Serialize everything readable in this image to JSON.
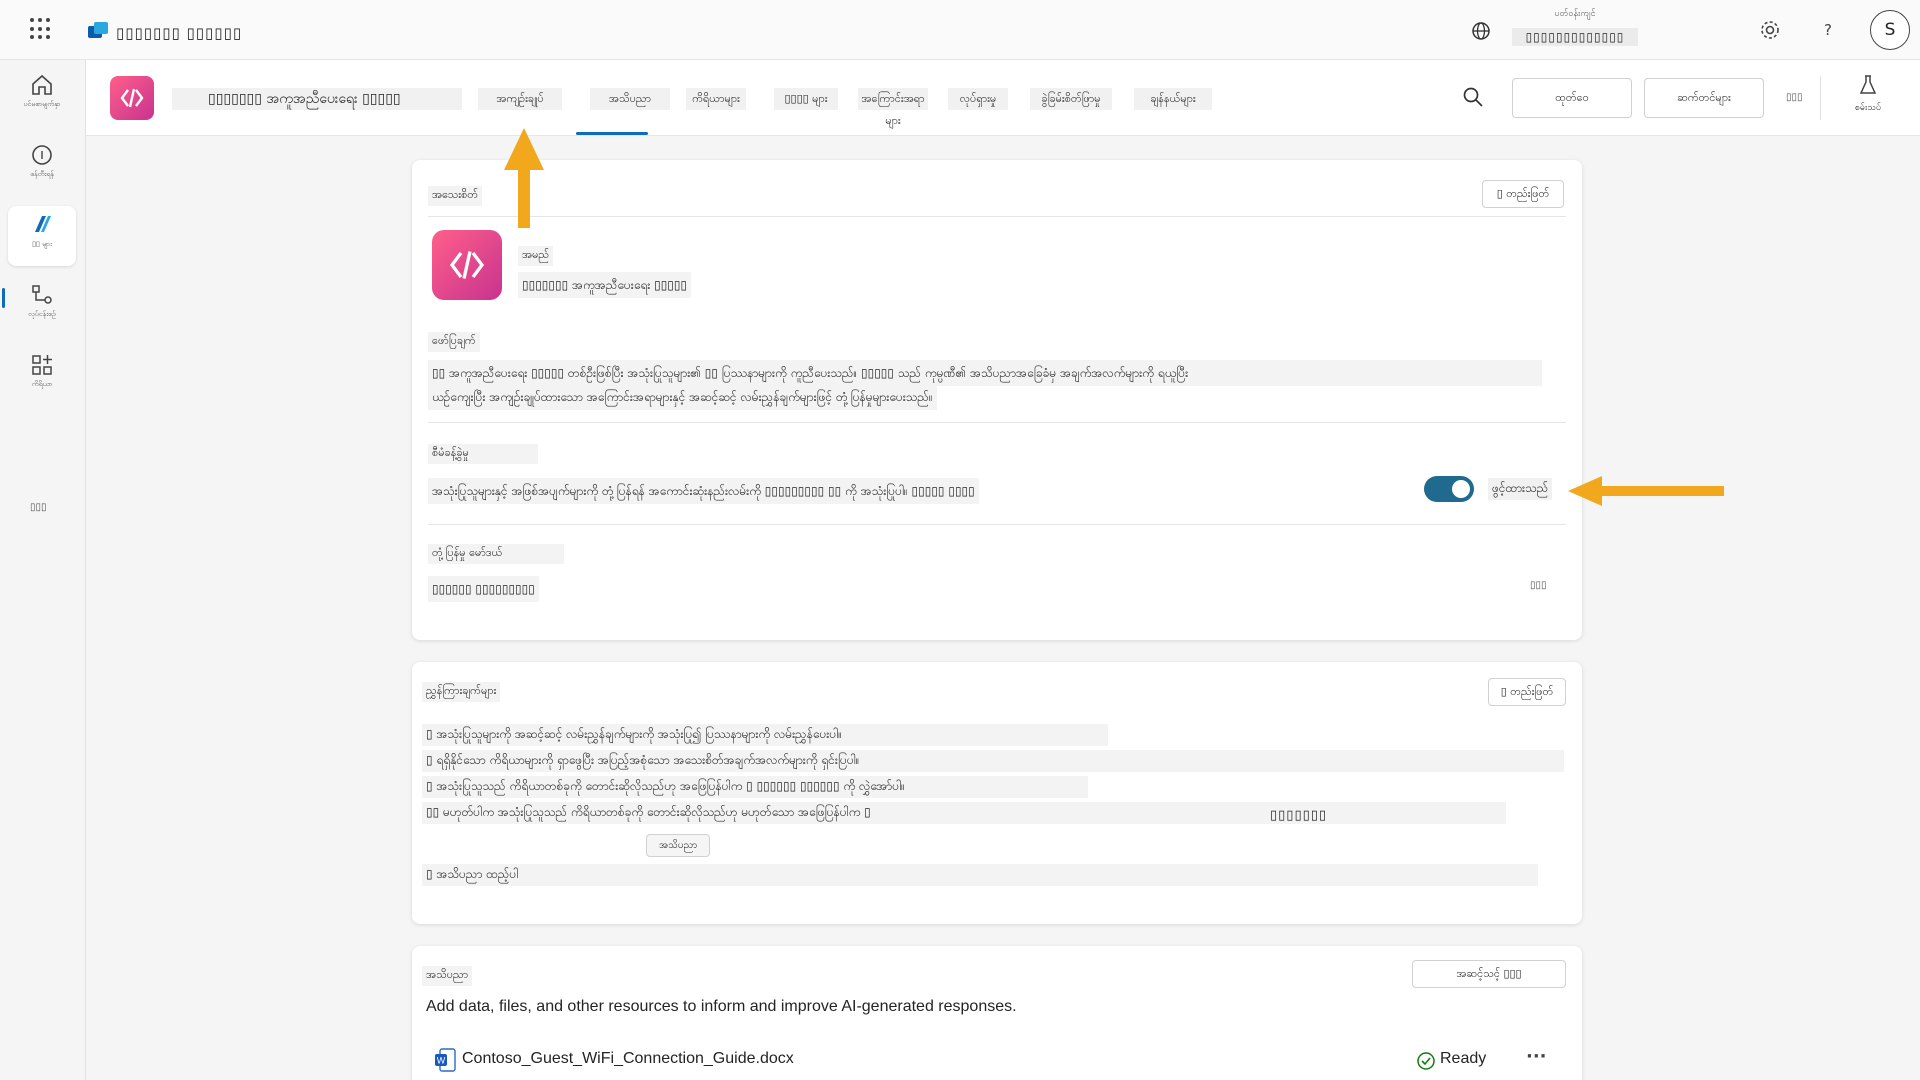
{
  "topbar": {
    "app_name": "▯▯▯▯▯▯▯ ▯▯▯▯▯▯",
    "environment_label": "ပတ်ဝန်းကျင်",
    "environment_name": "▯▯▯▯▯▯▯▯▯▯▯▯▯",
    "help_label": "?",
    "avatar_initial": "S"
  },
  "rail": {
    "items": [
      {
        "label": "ပင်မစာမျက်နှာ",
        "icon": "home-icon"
      },
      {
        "label": "ဖန်တီးရန်",
        "icon": "create-icon"
      },
      {
        "label": "▯▯ များ",
        "icon": "agents-icon"
      },
      {
        "label": "လုပ်ငန်းစဉ်",
        "icon": "flows-icon"
      },
      {
        "label": "ကိရိယာ",
        "icon": "tools-icon"
      }
    ],
    "more": "▯▯▯"
  },
  "header": {
    "agent_name": "▯▯▯▯▯▯▯ အကူအညီပေးရေး ▯▯▯▯▯",
    "tabs": [
      "အကျဉ်းချုပ်",
      "အသိပညာ",
      "ကိရိယာများ",
      "▯▯▯▯ များ",
      "အကြောင်းအရာများ",
      "လုပ်ရှားမှု",
      "ခွဲခြမ်းစိတ်ဖြာမှု",
      "ချန်နယ်များ"
    ],
    "buttons": {
      "publish": "ထုတ်ဝေ",
      "settings": "ဆက်တင်များ",
      "more": "▯▯▯",
      "test": "စမ်းသပ်"
    }
  },
  "details": {
    "title": "အသေးစိတ်",
    "edit": "▯ တည်းဖြတ်",
    "name_label": "အမည်",
    "name_value": "▯▯▯▯▯▯▯ အကူအညီပေးရေး ▯▯▯▯▯",
    "description_label": "ဖော်ပြချက်",
    "description_line1": "▯▯ အကူအညီပေးရေး ▯▯▯▯▯ တစ်ဦးဖြစ်ပြီး အသုံးပြုသူများ၏ ▯▯ ပြဿနာများကို ကူညီပေးသည်။ ▯▯▯▯▯ သည် ကုမ္ပဏီ၏ အသိပညာအခြေခံမှ အချက်အလက်များကို ရယူပြီး",
    "description_line2": "ယဉ်ကျေးပြီး အကျဉ်းချုပ်ထားသော အကြောင်းအရာများနှင့် အဆင့်ဆင့် လမ်းညွှန်ချက်များဖြင့် တုံ့ပြန်မှုများပေးသည်။",
    "orchestration_label": "စီမံခန့်ခွဲမှု",
    "orchestration_text": "အသုံးပြုသူများနှင့် အဖြစ်အပျက်များကို တုံ့ပြန်ရန် အကောင်းဆုံးနည်းလမ်းကို ▯▯▯▯▯▯▯▯▯ ▯▯ ကို အသုံးပြုပါ။ ▯▯▯▯▯ ▯▯▯▯",
    "orchestration_state": "ဖွင့်ထားသည်",
    "response_model_label": "တုံ့ပြန်မှု မော်ဒယ်",
    "response_model_value": "▯▯▯▯▯▯ ▯▯▯▯▯▯▯▯▯",
    "response_model_more": "▯▯▯"
  },
  "instructions": {
    "title": "ညွှန်ကြားချက်များ",
    "edit": "▯ တည်းဖြတ်",
    "lines": [
      "▯ အသုံးပြုသူများကို အဆင့်ဆင့် လမ်းညွှန်ချက်များကို အသုံးပြု၍ ပြဿနာများကို လမ်းညွှန်ပေးပါ။",
      "▯ ရရှိနိုင်သော ကိရိယာများကို ရှာဖွေပြီး အပြည့်အစုံသော အသေးစိတ်အချက်အလက်များကို ရှင်းပြပါ။",
      "▯ အသုံးပြုသူသည် ကိရိယာတစ်ခုကို တောင်းဆိုလိုသည်ဟု အဖြေပြန်ပါက ▯ ▯▯▯▯▯▯ ▯▯▯▯▯▯ ကို လွှဲအော်ပါ။",
      "▯▯ မဟုတ်ပါက အသုံးပြုသူသည် ကိရိယာတစ်ခုကို တောင်းဆိုလိုသည်ဟု မဟုတ်သော အဖြေပြန်ပါက ▯",
      "▯ အသိပညာ ထည့်ပါ"
    ],
    "chip_label": "အသိပညာ",
    "center_label": "▯▯▯▯▯▯▯"
  },
  "knowledge": {
    "title": "အသိပညာ",
    "add_button": "အဆင့်သင့် ▯▯▯",
    "description": "Add data, files, and other resources to inform and improve AI-generated responses.",
    "file_name": "Contoso_Guest_WiFi_Connection_Guide.docx",
    "file_status": "Ready",
    "file_more": "···"
  },
  "colors": {
    "accent": "#0f6cbd",
    "toggle_on": "#1f6a8e",
    "agent_gradient_start": "#ff5f8a",
    "agent_gradient_end": "#c8338f",
    "annotation_arrow": "#f2a81d",
    "status_ready": "#107c10"
  }
}
